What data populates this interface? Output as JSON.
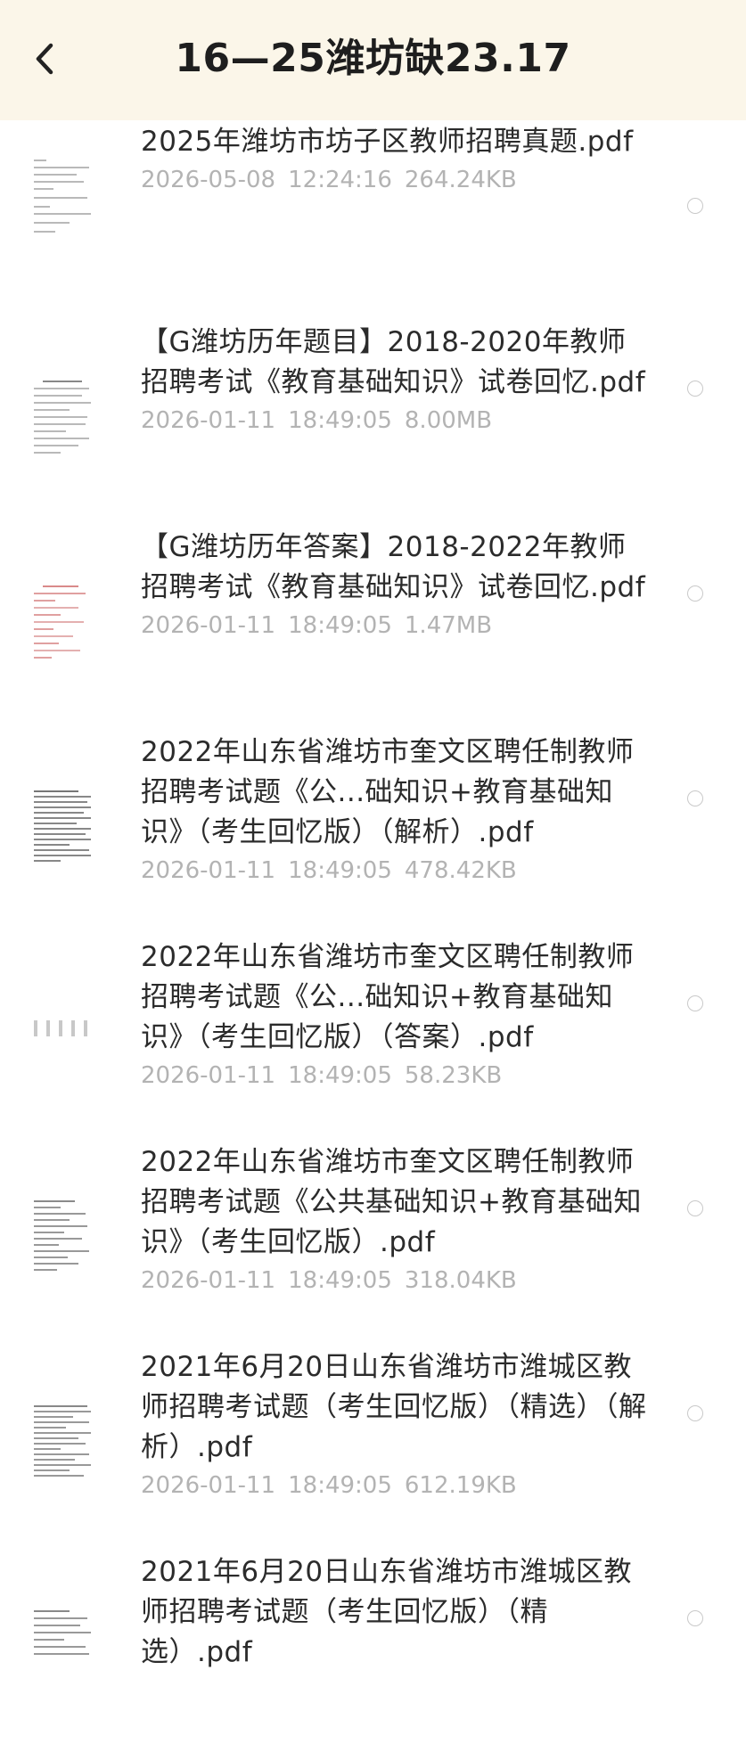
{
  "header": {
    "title": "16—25潍坊缺23.17",
    "back_icon": "chevron-left-icon"
  },
  "files": [
    {
      "name": "2025年潍坊市坊子区教师招聘真题.pdf",
      "date": "2026-05-08",
      "time": "12:24:16",
      "size": "264.24KB",
      "icon": "pdf-thumbnail-icon"
    },
    {
      "name": "【G潍坊历年题目】2018-2020年教师招聘考试《教育基础知识》试卷回忆.pdf",
      "date": "2026-01-11",
      "time": "18:49:05",
      "size": "8.00MB",
      "icon": "pdf-thumbnail-icon"
    },
    {
      "name": "【G潍坊历年答案】2018-2022年教师招聘考试《教育基础知识》试卷回忆.pdf",
      "date": "2026-01-11",
      "time": "18:49:05",
      "size": "1.47MB",
      "icon": "pdf-thumbnail-icon"
    },
    {
      "name": "2022年山东省潍坊市奎文区聘任制教师招聘考试题《公...础知识+教育基础知识》（考生回忆版）（解析）.pdf",
      "date": "2026-01-11",
      "time": "18:49:05",
      "size": "478.42KB",
      "icon": "pdf-thumbnail-icon"
    },
    {
      "name": "2022年山东省潍坊市奎文区聘任制教师招聘考试题《公...础知识+教育基础知识》（考生回忆版）（答案）.pdf",
      "date": "2026-01-11",
      "time": "18:49:05",
      "size": "58.23KB",
      "icon": "pdf-thumbnail-icon"
    },
    {
      "name": "2022年山东省潍坊市奎文区聘任制教师招聘考试题《公共基础知识+教育基础知识》（考生回忆版）.pdf",
      "date": "2026-01-11",
      "time": "18:49:05",
      "size": "318.04KB",
      "icon": "pdf-thumbnail-icon"
    },
    {
      "name": "2021年6月20日山东省潍坊市潍城区教师招聘考试题（考生回忆版）（精选）（解析）.pdf",
      "date": "2026-01-11",
      "time": "18:49:05",
      "size": "612.19KB",
      "icon": "pdf-thumbnail-icon"
    },
    {
      "name": "2021年6月20日山东省潍坊市潍城区教师招聘考试题（考生回忆版）（精选）.pdf",
      "date": "",
      "time": "",
      "size": "",
      "icon": "pdf-thumbnail-icon"
    }
  ]
}
